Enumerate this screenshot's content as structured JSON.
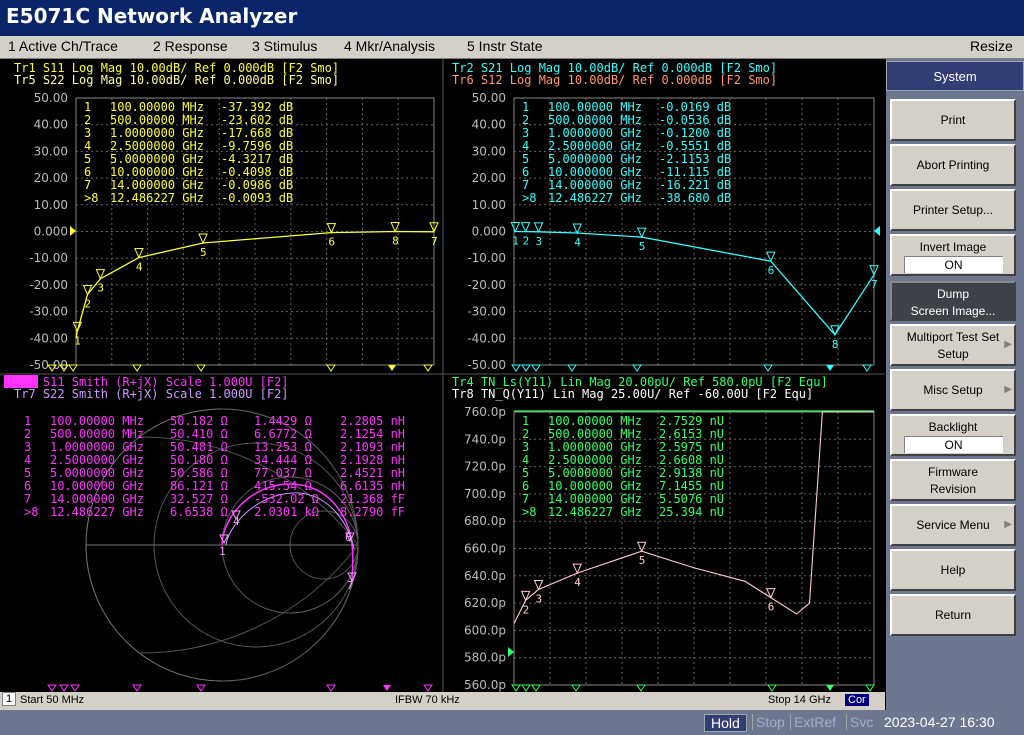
{
  "window": {
    "title": "E5071C Network Analyzer"
  },
  "menu": {
    "items": [
      "1 Active Ch/Trace",
      "2 Response",
      "3 Stimulus",
      "4 Mkr/Analysis",
      "5 Instr State"
    ],
    "resize": "Resize"
  },
  "softkeys": {
    "header": "System",
    "buttons": [
      {
        "label": "Print"
      },
      {
        "label": "Abort Printing"
      },
      {
        "label": "Printer Setup..."
      },
      {
        "label": "Invert Image",
        "value": "ON"
      },
      {
        "label": "Dump",
        "label2": "Screen Image...",
        "selected": true
      },
      {
        "label": "Multiport Test Set",
        "label2": "Setup",
        "submenu": true
      },
      {
        "label": "Misc Setup",
        "submenu": true
      },
      {
        "label": "Backlight",
        "value": "ON"
      },
      {
        "label": "Firmware",
        "label2": "Revision"
      },
      {
        "label": "Service Menu",
        "submenu": true
      },
      {
        "label": "Help"
      },
      {
        "label": "Return"
      }
    ]
  },
  "panels": {
    "p1": {
      "trace_lines": [
        {
          "text": "Tr1  S11  Log Mag 10.00dB/ Ref 0.000dB [F2 Smo]",
          "color": "#ffff33"
        },
        {
          "text": "Tr5  S22  Log Mag 10.00dB/ Ref 0.000dB [F2 Smo]",
          "color": "#ffff99"
        }
      ],
      "y_ticks": [
        "50.00",
        "40.00",
        "30.00",
        "20.00",
        "10.00",
        "0.000",
        "-10.00",
        "-20.00",
        "-30.00",
        "-40.00",
        "-50.00"
      ],
      "markers": [
        {
          "n": "1",
          "f": "100.00000 MHz",
          "v": "-37.392 dB"
        },
        {
          "n": "2",
          "f": "500.00000 MHz",
          "v": "-23.602 dB"
        },
        {
          "n": "3",
          "f": "1.0000000 GHz",
          "v": "-17.668 dB"
        },
        {
          "n": "4",
          "f": "2.5000000 GHz",
          "v": "-9.7596 dB"
        },
        {
          "n": "5",
          "f": "5.0000000 GHz",
          "v": "-4.3217 dB"
        },
        {
          "n": "6",
          "f": "10.000000 GHz",
          "v": "-0.4098 dB"
        },
        {
          "n": "7",
          "f": "14.000000 GHz",
          "v": "-0.0986 dB"
        },
        {
          "n": ">8",
          "f": "12.486227 GHz",
          "v": "-0.0093 dB"
        }
      ]
    },
    "p2": {
      "trace_lines": [
        {
          "text": "Tr2  S21  Log Mag 10.00dB/ Ref 0.000dB [F2 Smo]",
          "color": "#33ffff"
        },
        {
          "text": "Tr6  S12  Log Mag 10.00dB/ Ref 0.000dB [F2 Smo]",
          "color": "#ff9966"
        }
      ],
      "y_ticks": [
        "50.00",
        "40.00",
        "30.00",
        "20.00",
        "10.00",
        "0.000",
        "-10.00",
        "-20.00",
        "-30.00",
        "-40.00",
        "-50.00"
      ],
      "markers": [
        {
          "n": "1",
          "f": "100.00000 MHz",
          "v": "-0.0169 dB"
        },
        {
          "n": "2",
          "f": "500.00000 MHz",
          "v": "-0.0536 dB"
        },
        {
          "n": "3",
          "f": "1.0000000 GHz",
          "v": "-0.1200 dB"
        },
        {
          "n": "4",
          "f": "2.5000000 GHz",
          "v": "-0.5551 dB"
        },
        {
          "n": "5",
          "f": "5.0000000 GHz",
          "v": "-2.1153 dB"
        },
        {
          "n": "6",
          "f": "10.000000 GHz",
          "v": "-11.115 dB"
        },
        {
          "n": "7",
          "f": "14.000000 GHz",
          "v": "-16.221 dB"
        },
        {
          "n": ">8",
          "f": "12.486227 GHz",
          "v": "-38.680 dB"
        }
      ]
    },
    "p3": {
      "trace_lines": [
        {
          "text": "Tr3  S11  Smith (R+jX) Scale 1.000U [F2]",
          "color": "#ff33ff",
          "highlight": "Tr3"
        },
        {
          "text": "Tr7  S22  Smith (R+jX) Scale 1.000U [F2]",
          "color": "#cc99ff"
        }
      ],
      "markers": [
        {
          "n": "1",
          "f": "100.00000 MHz",
          "r": "50.182 Ω",
          "x": "1.4429 Ω",
          "l": "2.2805 nH"
        },
        {
          "n": "2",
          "f": "500.00000 MHz",
          "r": "50.410 Ω",
          "x": "6.6772 Ω",
          "l": "2.1254 nH"
        },
        {
          "n": "3",
          "f": "1.0000000 GHz",
          "r": "50.481 Ω",
          "x": "13.253 Ω",
          "l": "2.1093 nH"
        },
        {
          "n": "4",
          "f": "2.5000000 GHz",
          "r": "50.180 Ω",
          "x": "34.444 Ω",
          "l": "2.1928 nH"
        },
        {
          "n": "5",
          "f": "5.0000000 GHz",
          "r": "50.586 Ω",
          "x": "77.037 Ω",
          "l": "2.4521 nH"
        },
        {
          "n": "6",
          "f": "10.000000 GHz",
          "r": "86.121 Ω",
          "x": "415.54 Ω",
          "l": "6.6135 nH"
        },
        {
          "n": "7",
          "f": "14.000000 GHz",
          "r": "32.527 Ω",
          "x": "-532.02 Ω",
          "l": "21.368 fF"
        },
        {
          "n": ">8",
          "f": "12.486227 GHz",
          "r": "6.6538 Ω",
          "x": "2.0301 kΩ",
          "l": "8.2790 fF"
        }
      ]
    },
    "p4": {
      "trace_lines": [
        {
          "text": "Tr4  TN_Ls(Y11) Lin Mag 20.00pU/ Ref 580.0pU [F2 Equ]",
          "color": "#33ff66"
        },
        {
          "text": "Tr8  TN_Q(Y11) Lin Mag 25.00U/ Ref -60.00U [F2 Equ]",
          "color": "#ffffff"
        }
      ],
      "y_ticks": [
        "760.0p",
        "740.0p",
        "720.0p",
        "700.0p",
        "680.0p",
        "660.0p",
        "640.0p",
        "620.0p",
        "600.0p",
        "580.0p",
        "560.0p"
      ],
      "markers": [
        {
          "n": "1",
          "f": "100.00000 MHz",
          "v": "2.7529 nU"
        },
        {
          "n": "2",
          "f": "500.00000 MHz",
          "v": "2.6153 nU"
        },
        {
          "n": "3",
          "f": "1.0000000 GHz",
          "v": "2.5975 nU"
        },
        {
          "n": "4",
          "f": "2.5000000 GHz",
          "v": "2.6608 nU"
        },
        {
          "n": "5",
          "f": "5.0000000 GHz",
          "v": "2.9138 nU"
        },
        {
          "n": "6",
          "f": "10.000000 GHz",
          "v": "7.1455 nU"
        },
        {
          "n": "7",
          "f": "14.000000 GHz",
          "v": "5.5076 nU"
        },
        {
          "n": ">8",
          "f": "12.486227 GHz",
          "v": "25.394 nU"
        }
      ]
    }
  },
  "info": {
    "channel": "1",
    "start": "Start 50 MHz",
    "ifbw": "IFBW 70 kHz",
    "stop": "Stop 14 GHz",
    "cor": "Cor"
  },
  "status": {
    "hold": "Hold",
    "stop": "Stop",
    "extref": "ExtRef",
    "svc": "Svc",
    "datetime": "2023-04-27 16:30"
  },
  "chart_data": [
    {
      "type": "line",
      "xlim": [
        0.05,
        14
      ],
      "ylim": [
        -50,
        50
      ],
      "x_unit": "GHz",
      "y_unit": "dB",
      "series": [
        {
          "name": "Tr1 S11",
          "x": [
            0.05,
            0.1,
            0.5,
            1,
            2.5,
            5,
            10,
            12.486227,
            14
          ],
          "values": [
            -40,
            -37.392,
            -23.602,
            -17.668,
            -9.7596,
            -4.3217,
            -0.4098,
            -0.0093,
            -0.0986
          ]
        }
      ]
    },
    {
      "type": "line",
      "xlim": [
        0.05,
        14
      ],
      "ylim": [
        -50,
        50
      ],
      "x_unit": "GHz",
      "y_unit": "dB",
      "series": [
        {
          "name": "Tr2 S21",
          "x": [
            0.05,
            0.1,
            0.5,
            1,
            2.5,
            5,
            10,
            12.486227,
            14
          ],
          "values": [
            0,
            -0.0169,
            -0.0536,
            -0.12,
            -0.5551,
            -2.1153,
            -11.115,
            -38.68,
            -16.221
          ]
        }
      ]
    },
    {
      "type": "line",
      "xlim": [
        0.05,
        14
      ],
      "ylim": [
        560,
        760
      ],
      "x_unit": "GHz",
      "y_unit": "pU",
      "series": [
        {
          "name": "Tr4 TN_Ls(Y11)",
          "x": [
            0.05,
            0.5,
            1,
            2.5,
            5,
            7,
            9,
            10,
            11,
            11.5,
            12,
            13,
            14
          ],
          "values": [
            605,
            622,
            630,
            642,
            658,
            646,
            636,
            624,
            612,
            620,
            760,
            760,
            760
          ]
        }
      ]
    }
  ]
}
